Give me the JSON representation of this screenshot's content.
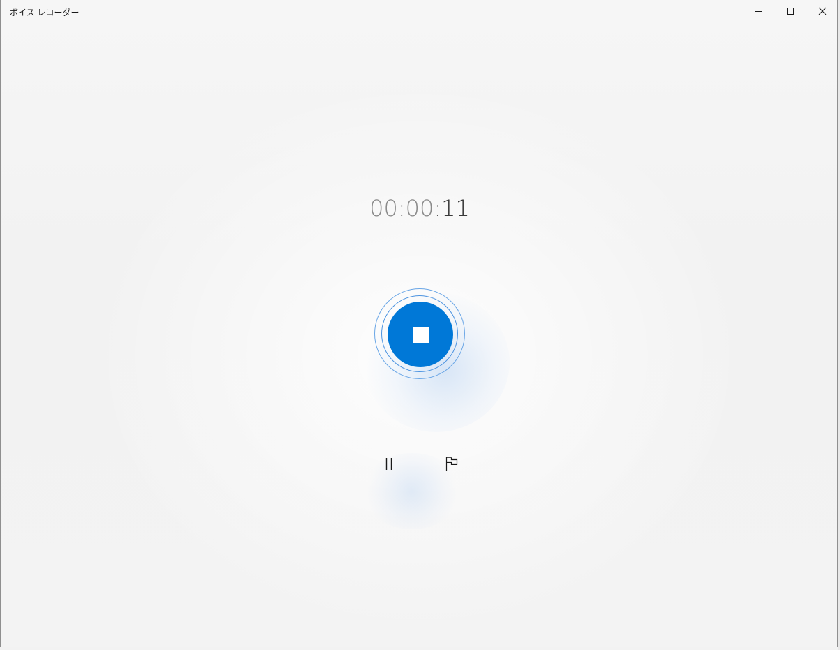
{
  "window": {
    "title": "ボイス レコーダー"
  },
  "caption_buttons": {
    "minimize_icon": "minimize-icon",
    "maximize_icon": "maximize-icon",
    "close_icon": "close-icon"
  },
  "timer": {
    "hours": "00",
    "minutes": "00",
    "seconds": "11",
    "separator": ":"
  },
  "controls": {
    "stop_icon": "stop-icon",
    "pause_icon": "pause-icon",
    "flag_icon": "flag-icon"
  },
  "colors": {
    "accent": "#0078d7",
    "ring": "#6aa6e6",
    "background": "#f3f3f3"
  }
}
